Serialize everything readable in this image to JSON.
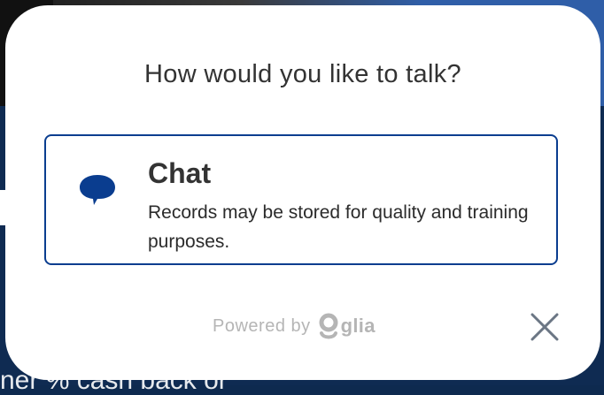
{
  "background": {
    "partial_text": "ner % cash back or"
  },
  "modal": {
    "title": "How would you like to talk?",
    "option": {
      "icon": "chat-bubble-icon",
      "title": "Chat",
      "description": "Records may be stored for quality and training purposes."
    },
    "footer": {
      "powered_by": "Powered by",
      "brand": "glia"
    },
    "close_icon": "close-icon"
  },
  "colors": {
    "accent": "#0a3d8f",
    "text": "#333333",
    "muted": "#b5b5b5",
    "close": "#6b7684"
  }
}
